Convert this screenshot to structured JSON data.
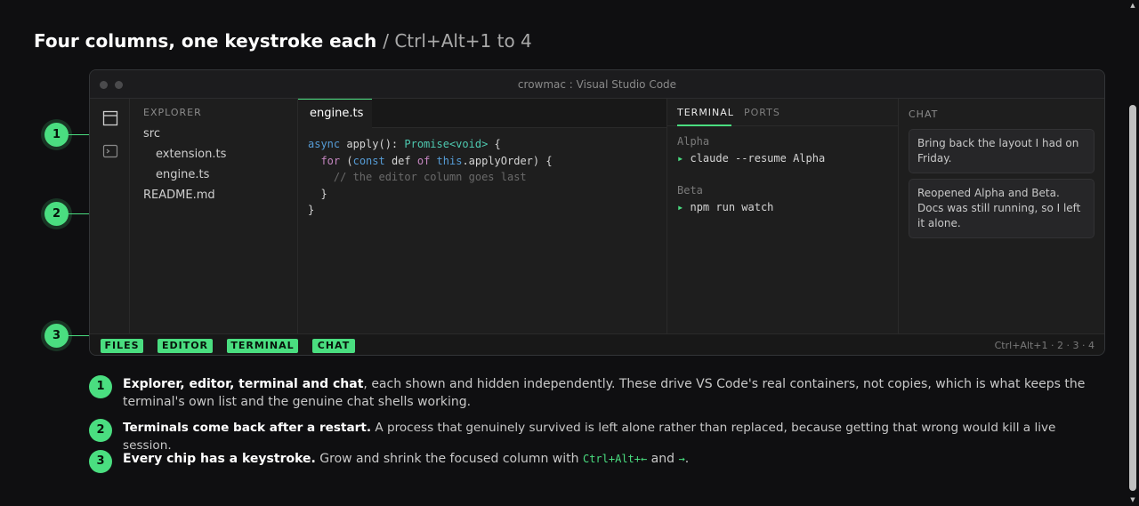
{
  "heading": {
    "title": "Four columns, one keystroke each",
    "subtitle": "/ Ctrl+Alt+1 to 4"
  },
  "window": {
    "title": "crowmac : Visual Studio Code"
  },
  "explorer": {
    "header": "EXPLORER",
    "items": [
      {
        "label": "src"
      },
      {
        "label": "extension.ts"
      },
      {
        "label": "engine.ts"
      },
      {
        "label": "README.md"
      }
    ]
  },
  "editor": {
    "tab": "engine.ts",
    "code": {
      "l1_kw": "async",
      "l1_fn": " apply(): ",
      "l1_type": "Promise<void>",
      "l1_end": " {",
      "l2_for": "for",
      "l2_paren": " (",
      "l2_const": "const",
      "l2_def": " def ",
      "l2_of": "of",
      "l2_sp": " ",
      "l2_this": "this",
      "l2_rest": ".applyOrder) {",
      "l3_comment": "// the editor column goes last",
      "l4": "}",
      "l5": "}"
    }
  },
  "terminal": {
    "tabs": [
      "TERMINAL",
      "PORTS"
    ],
    "sessions": [
      {
        "name": "Alpha",
        "prompt": "▸",
        "command": "claude --resume Alpha"
      },
      {
        "name": "Beta",
        "prompt": "▸",
        "command": "npm run watch"
      }
    ]
  },
  "chat": {
    "header": "CHAT",
    "messages": [
      {
        "text": "Bring back the layout I had on Friday."
      },
      {
        "text": "Reopened Alpha and Beta. Docs was still running, so I left it alone."
      }
    ]
  },
  "statusbar": {
    "chips": [
      "FILES",
      "EDITOR",
      "TERMINAL",
      "CHAT"
    ],
    "shortcut": "Ctrl+Alt+1 · 2 · 3 · 4"
  },
  "markers": [
    "1",
    "2",
    "3"
  ],
  "notes": [
    {
      "num": "1",
      "bold": "Explorer, editor, terminal and chat",
      "text": ", each shown and hidden independently. These drive VS Code's real containers, not copies, which is what keeps the terminal's own list and the genuine chat shells working."
    },
    {
      "num": "2",
      "bold": "Terminals come back after a restart.",
      "text": " A process that genuinely survived is left alone rather than replaced, because getting that wrong would kill a live session."
    },
    {
      "num": "3",
      "bold": "Every chip has a keystroke.",
      "text": " Grow and shrink the focused column with ",
      "code1": "Ctrl+Alt+←",
      "mid": " and ",
      "code2": "→",
      "end": "."
    }
  ],
  "colors": {
    "accent": "#4ade80",
    "background": "#0f0f11",
    "panel": "#1e1e1e"
  }
}
